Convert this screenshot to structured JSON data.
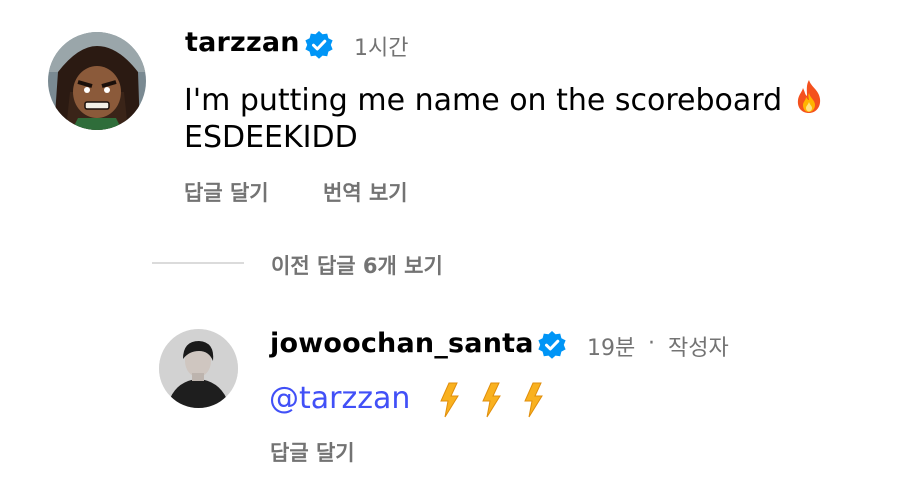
{
  "comment": {
    "username": "tarzzan",
    "verified_icon": "verified-badge-icon",
    "time": "1시간",
    "text_line1": "I'm putting me name on the scoreboard",
    "text_line2": "ESDEEKIDD",
    "emoji": "fire-emoji",
    "reply_label": "답글 달기",
    "translate_label": "번역 보기"
  },
  "view_previous_replies": "이전 답글 6개 보기",
  "reply": {
    "username": "jowoochan_santa",
    "verified_icon": "verified-badge-icon",
    "time": "19분",
    "separator": "·",
    "author_label": "작성자",
    "mention": "@tarzzan",
    "emoji": "lightning-emoji",
    "reply_label": "답글 달기"
  },
  "colors": {
    "secondary_text": "#737373",
    "verified_blue": "#0095f6",
    "mention_blue": "#4150f7",
    "divider": "#dbdbdb"
  }
}
